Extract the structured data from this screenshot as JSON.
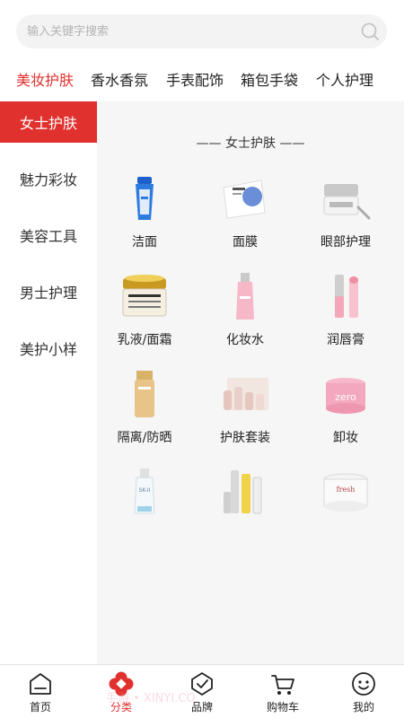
{
  "search": {
    "placeholder": "输入关键字搜索",
    "icon": "search-icon"
  },
  "top_tabs": [
    {
      "label": "美妆护肤",
      "active": true
    },
    {
      "label": "香水香氛",
      "active": false
    },
    {
      "label": "手表配饰",
      "active": false
    },
    {
      "label": "箱包手袋",
      "active": false
    },
    {
      "label": "个人护理",
      "active": false
    }
  ],
  "sidebar": {
    "items": [
      {
        "label": "女士护肤",
        "active": true
      },
      {
        "label": "魅力彩妆",
        "active": false
      },
      {
        "label": "美容工具",
        "active": false
      },
      {
        "label": "男士护理",
        "active": false
      },
      {
        "label": "美护小样",
        "active": false
      }
    ]
  },
  "content": {
    "section_title": "—— 女士护肤 ——",
    "items": [
      {
        "label": "洁面",
        "icon": "cleanser-tube-icon"
      },
      {
        "label": "面膜",
        "icon": "face-mask-icon"
      },
      {
        "label": "眼部护理",
        "icon": "eye-cream-jar-icon"
      },
      {
        "label": "乳液/面霜",
        "icon": "cream-jar-icon"
      },
      {
        "label": "化妆水",
        "icon": "toner-bottle-icon"
      },
      {
        "label": "润唇膏",
        "icon": "lip-balm-icon"
      },
      {
        "label": "隔离/防晒",
        "icon": "sunscreen-bottle-icon"
      },
      {
        "label": "护肤套装",
        "icon": "skincare-set-icon"
      },
      {
        "label": "卸妆",
        "icon": "makeup-remover-icon"
      },
      {
        "label": "",
        "icon": "essence-bottle-icon"
      },
      {
        "label": "",
        "icon": "skincare-kit-icon"
      },
      {
        "label": "",
        "icon": "face-cream-jar-icon"
      }
    ]
  },
  "bottom_nav": [
    {
      "label": "首页",
      "icon": "home-icon",
      "active": false
    },
    {
      "label": "分类",
      "icon": "category-icon",
      "active": true
    },
    {
      "label": "品牌",
      "icon": "brand-icon",
      "active": false
    },
    {
      "label": "购物车",
      "icon": "cart-icon",
      "active": false
    },
    {
      "label": "我的",
      "icon": "profile-icon",
      "active": false
    }
  ],
  "watermark": "手游 • XINYI.CO",
  "colors": {
    "accent": "#e0312f",
    "panel_bg": "#f6f6f6",
    "search_bg": "#f3f3f3"
  }
}
